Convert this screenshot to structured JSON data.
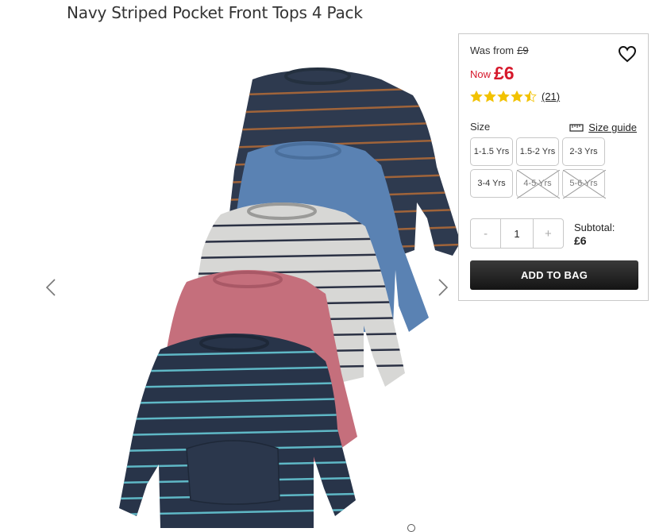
{
  "product": {
    "title": "Navy Striped Pocket Front Tops 4 Pack",
    "was_label": "Was from",
    "was_price": "£9",
    "now_label": "Now",
    "now_price": "£6",
    "rating": 4.5,
    "rating_count": "(21)"
  },
  "size": {
    "label": "Size",
    "guide_label": "Size guide",
    "options": [
      {
        "label": "1-1.5 Yrs",
        "available": true
      },
      {
        "label": "1.5-2 Yrs",
        "available": true
      },
      {
        "label": "2-3 Yrs",
        "available": true
      },
      {
        "label": "3-4 Yrs",
        "available": true
      },
      {
        "label": "4-5 Yrs",
        "available": false
      },
      {
        "label": "5-6 Yrs",
        "available": false
      }
    ]
  },
  "quantity": {
    "minus": "-",
    "value": "1",
    "plus": "+"
  },
  "subtotal": {
    "label": "Subtotal:",
    "value": "£6"
  },
  "actions": {
    "add_to_bag": "ADD TO BAG"
  },
  "gallery": {
    "icons": {
      "prev": "chevron-left-icon",
      "next": "chevron-right-icon"
    }
  },
  "colors": {
    "price_red": "#d6182b",
    "star": "#f2c200",
    "button_dark": "#1f1f1f"
  }
}
